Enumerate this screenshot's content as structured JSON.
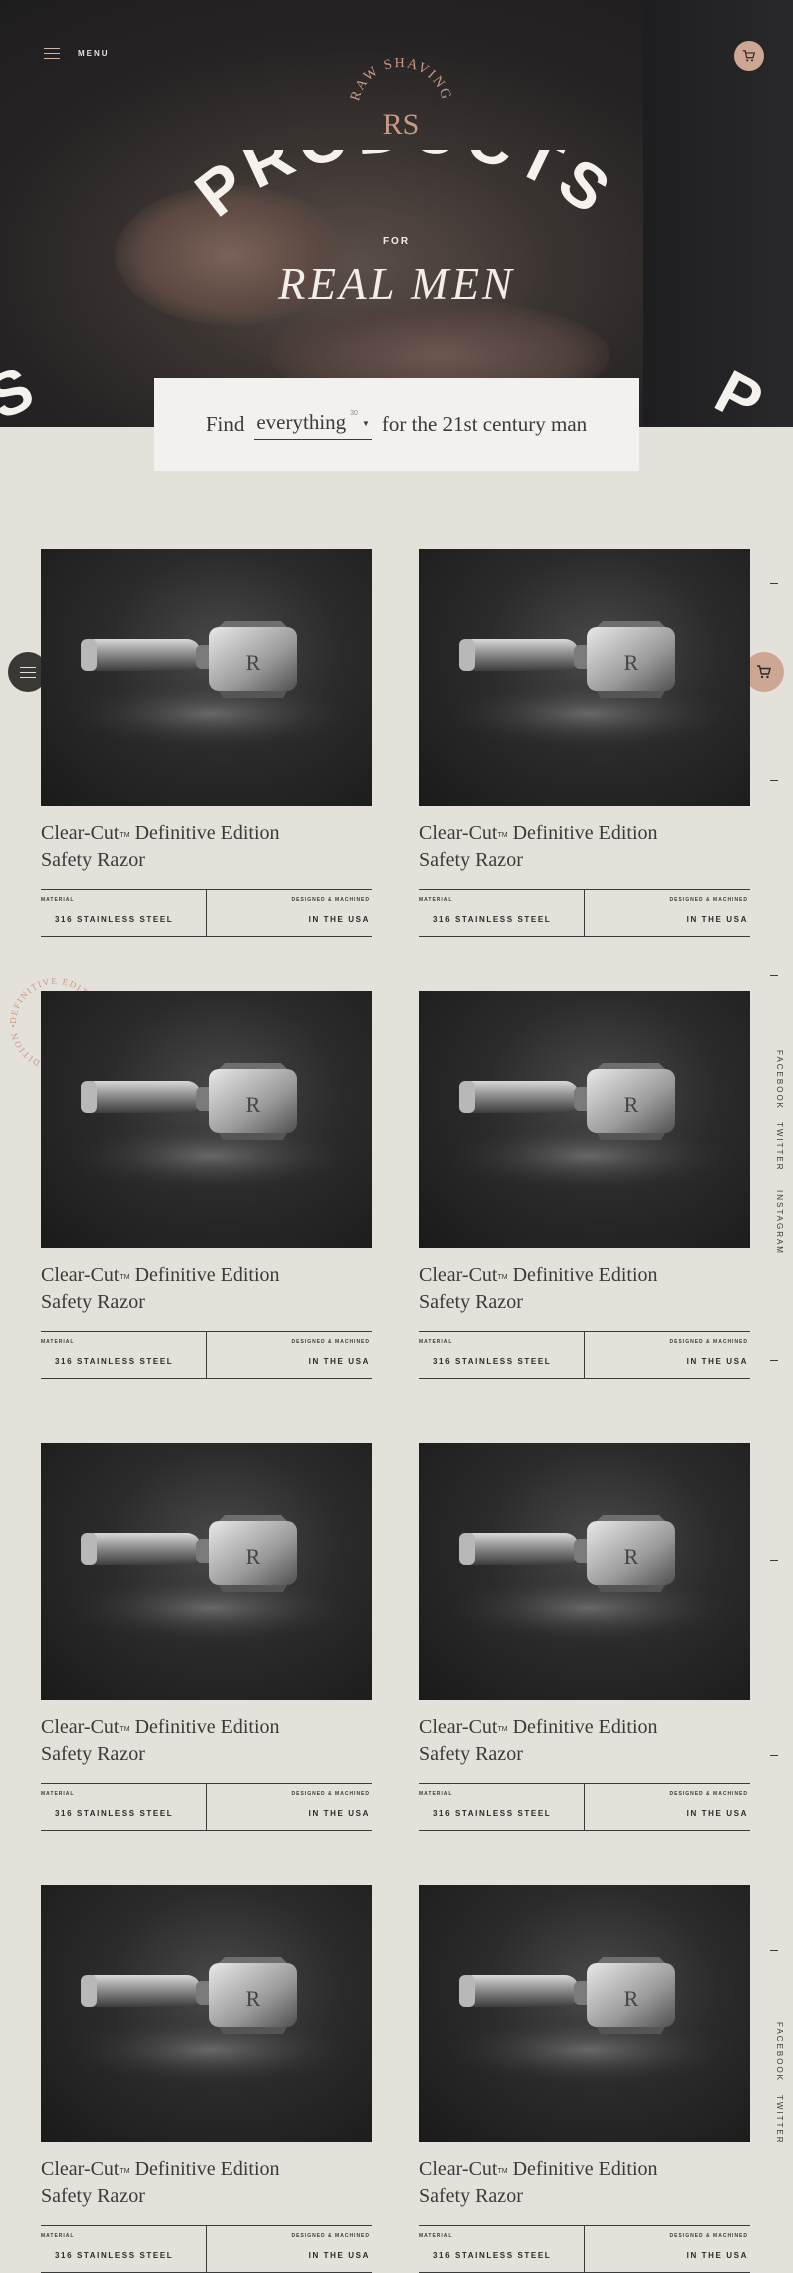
{
  "nav": {
    "menu_label": "MENU"
  },
  "hero": {
    "brand": "RAW SHAVING",
    "brand_monogram": "RS",
    "title": "PRODUCTS",
    "for": "FOR",
    "subtitle": "REAL MEN",
    "edge_left": "S",
    "edge_right": "P"
  },
  "filter": {
    "lead": "Find",
    "selected": "everything",
    "count": "30",
    "tail": "for the 21st century man"
  },
  "social": {
    "facebook": "FACEBOOK",
    "twitter": "TWITTER",
    "instagram": "INSTAGRAM"
  },
  "badge": {
    "text": "DEFINITIVE EDITION • DEFINITIVE EDITION •"
  },
  "products": [
    {
      "name_a": "Clear-Cut",
      "tm": "TM",
      "name_b": " Definitive Edition",
      "name_c": "Safety Razor",
      "material_label": "MATERIAL",
      "material": "316 STAINLESS STEEL",
      "origin_label": "DESIGNED & MACHINED",
      "origin": "IN THE USA"
    },
    {
      "name_a": "Clear-Cut",
      "tm": "TM",
      "name_b": " Definitive Edition",
      "name_c": "Safety Razor",
      "material_label": "MATERIAL",
      "material": "316 STAINLESS STEEL",
      "origin_label": "DESIGNED & MACHINED",
      "origin": "IN THE USA"
    },
    {
      "name_a": "Clear-Cut",
      "tm": "TM",
      "name_b": " Definitive Edition",
      "name_c": "Safety Razor",
      "material_label": "MATERIAL",
      "material": "316 STAINLESS STEEL",
      "origin_label": "DESIGNED & MACHINED",
      "origin": "IN THE USA"
    },
    {
      "name_a": "Clear-Cut",
      "tm": "TM",
      "name_b": " Definitive Edition",
      "name_c": "Safety Razor",
      "material_label": "MATERIAL",
      "material": "316 STAINLESS STEEL",
      "origin_label": "DESIGNED & MACHINED",
      "origin": "IN THE USA"
    },
    {
      "name_a": "Clear-Cut",
      "tm": "TM",
      "name_b": " Definitive Edition",
      "name_c": "Safety Razor",
      "material_label": "MATERIAL",
      "material": "316 STAINLESS STEEL",
      "origin_label": "DESIGNED & MACHINED",
      "origin": "IN THE USA"
    },
    {
      "name_a": "Clear-Cut",
      "tm": "TM",
      "name_b": " Definitive Edition",
      "name_c": "Safety Razor",
      "material_label": "MATERIAL",
      "material": "316 STAINLESS STEEL",
      "origin_label": "DESIGNED & MACHINED",
      "origin": "IN THE USA"
    },
    {
      "name_a": "Clear-Cut",
      "tm": "TM",
      "name_b": " Definitive Edition",
      "name_c": "Safety Razor",
      "material_label": "MATERIAL",
      "material": "316 STAINLESS STEEL",
      "origin_label": "DESIGNED & MACHINED",
      "origin": "IN THE USA"
    },
    {
      "name_a": "Clear-Cut",
      "tm": "TM",
      "name_b": " Definitive Edition",
      "name_c": "Safety Razor",
      "material_label": "MATERIAL",
      "material": "316 STAINLESS STEEL",
      "origin_label": "DESIGNED & MACHINED",
      "origin": "IN THE USA"
    }
  ],
  "colors": {
    "accent": "#cea794",
    "page_bg": "#e4e1db",
    "dark": "#1a1a1a"
  },
  "icons": {
    "menu": "hamburger-icon",
    "cart": "cart-icon"
  }
}
